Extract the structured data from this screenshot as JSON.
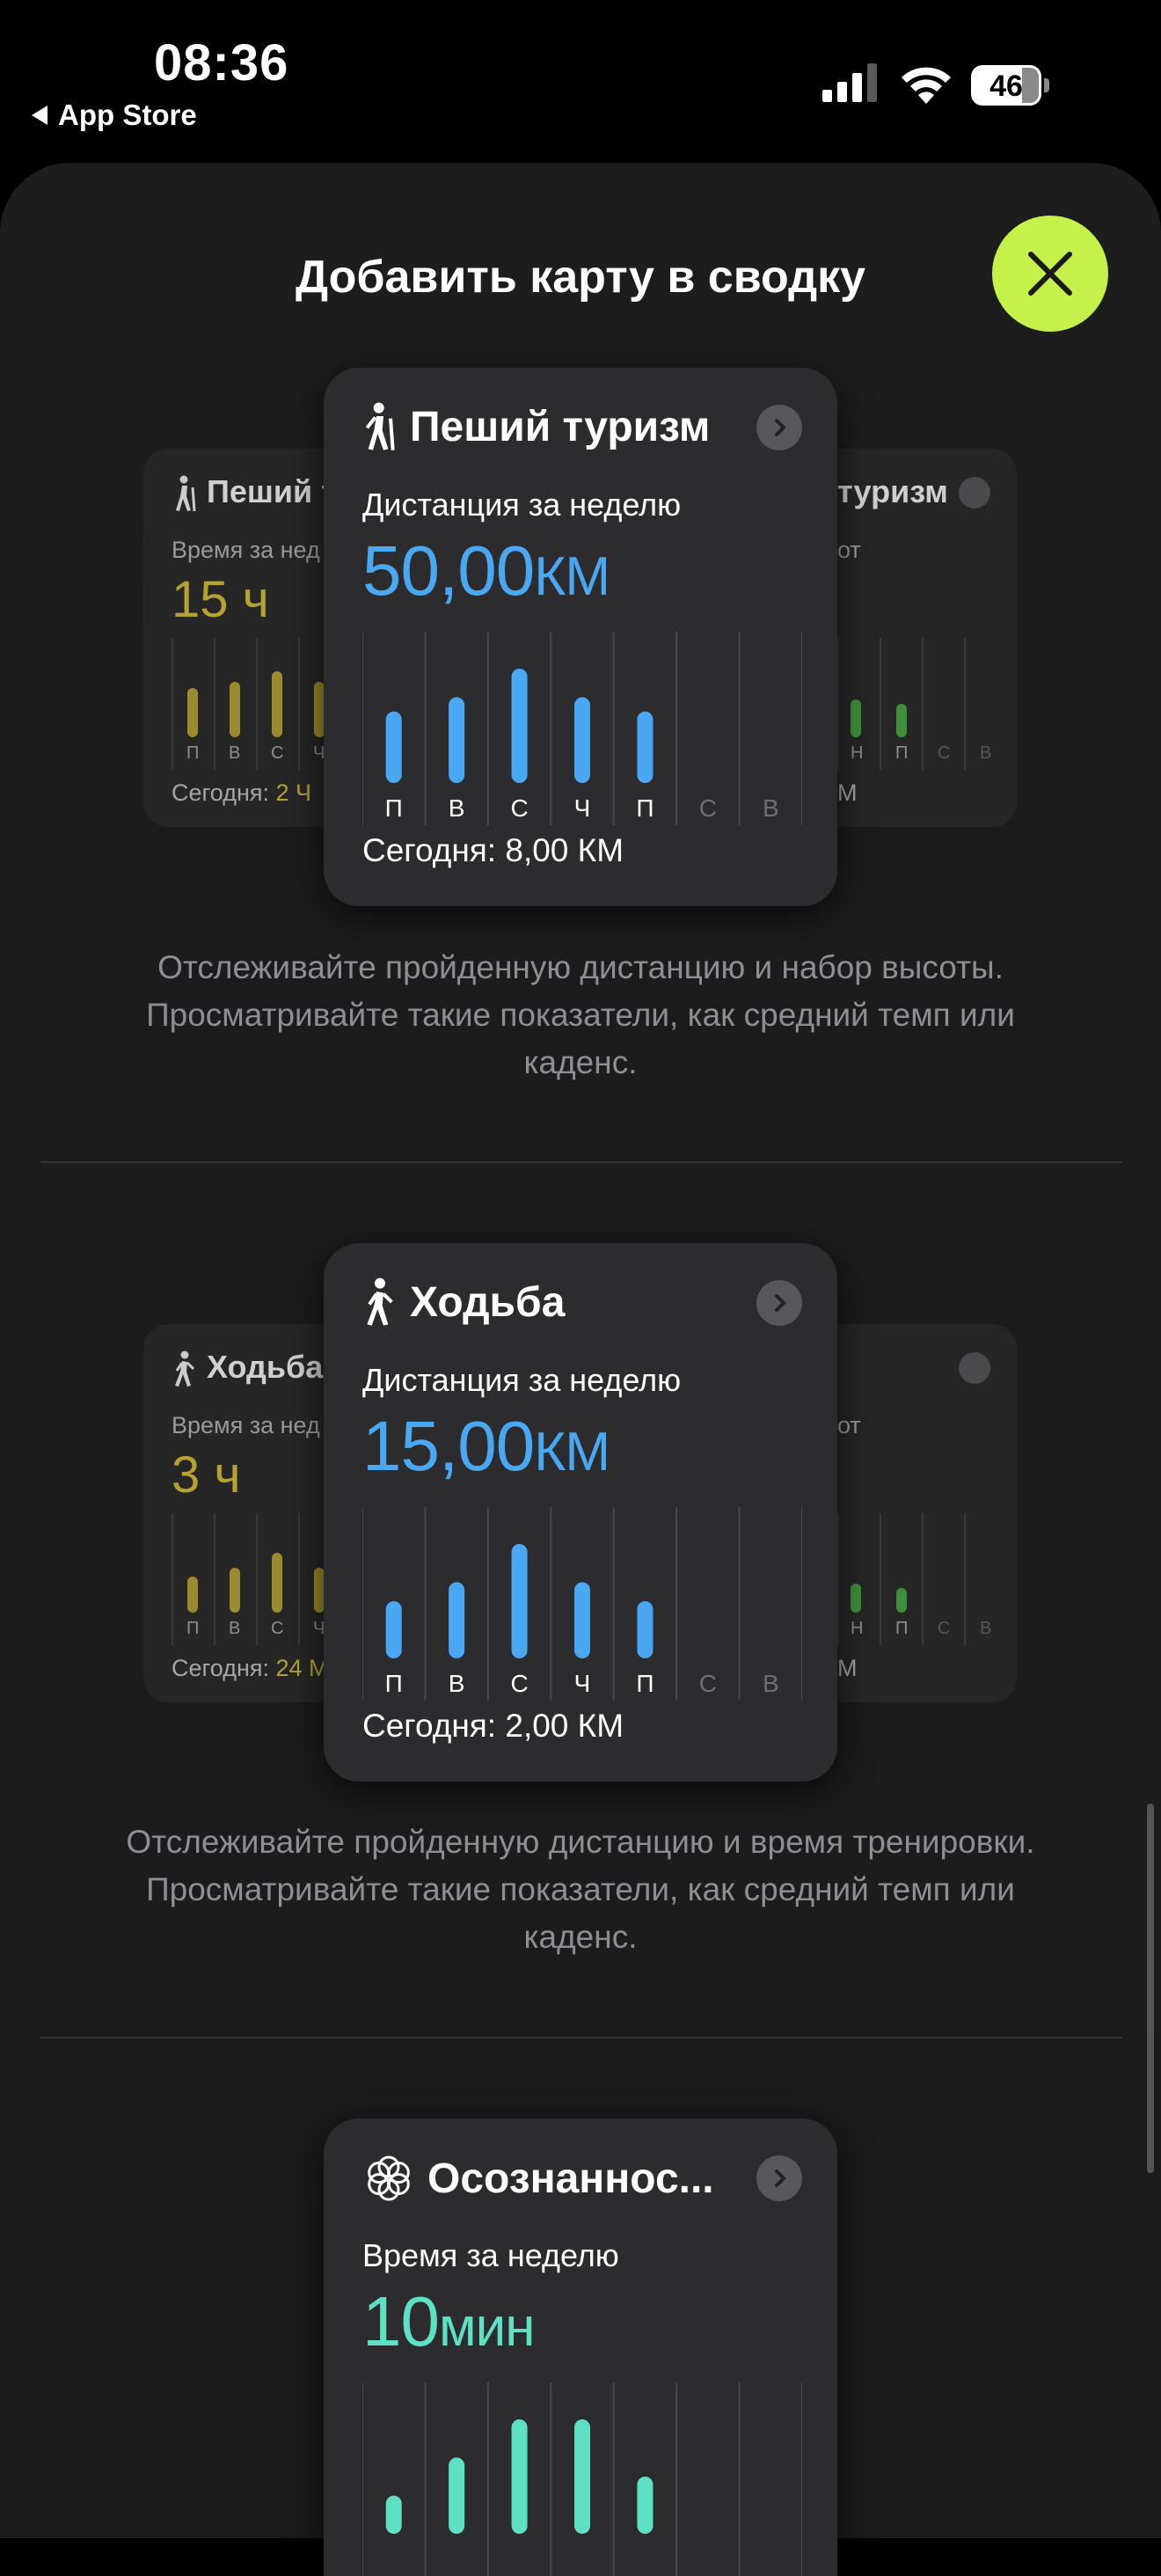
{
  "status_bar": {
    "time": "08:36",
    "back_label": "App Store",
    "battery": "46"
  },
  "sheet": {
    "title": "Добавить карту в сводку"
  },
  "cards": [
    {
      "title": "Пеший туризм",
      "subtitle": "Дистанция за неделю",
      "value": "50,00",
      "unit": "КМ",
      "today": "Сегодня: 8,00 КМ",
      "description": "Отслеживайте пройденную дистанцию и набор высоты. Просматривайте такие показатели, как средний темп или каденс.",
      "left_peek": {
        "title": "Пеший т",
        "subtitle": "Время за нед",
        "value": "15 ч",
        "today_label": "Сегодня: ",
        "today_value": "2 Ч"
      },
      "right_peek": {
        "title": "туризм",
        "subtitle": "от",
        "today": "М"
      }
    },
    {
      "title": "Ходьба",
      "subtitle": "Дистанция за неделю",
      "value": "15,00",
      "unit": "КМ",
      "today": "Сегодня: 2,00 КМ",
      "description": "Отслеживайте пройденную дистанцию и время тренировки. Просматривайте такие показатели, как средний темп или каденс.",
      "left_peek": {
        "title": "Ходьба",
        "subtitle": "Время за нед",
        "value": "3 ч",
        "today_label": "Сегодня: ",
        "today_value": "24 М"
      },
      "right_peek": {
        "subtitle": "от",
        "today": "М"
      }
    },
    {
      "title": "Осознаннос...",
      "subtitle": "Время за неделю",
      "value": "10",
      "unit": "мин"
    }
  ],
  "chart_data": [
    {
      "type": "bar",
      "categories": [
        "П",
        "В",
        "С",
        "Ч",
        "П",
        "С",
        "В"
      ],
      "values": [
        7.5,
        9,
        12,
        9,
        7.5,
        0,
        0
      ],
      "color": "#4aa8f2"
    },
    {
      "type": "bar",
      "categories": [
        "П",
        "В",
        "С",
        "Ч",
        "П",
        "С",
        "В"
      ],
      "values": [
        1.8,
        2.4,
        3.6,
        2.4,
        1.8,
        0,
        0
      ],
      "color": "#4aa8f2"
    },
    {
      "type": "bar",
      "categories": [
        "П",
        "В",
        "С",
        "Ч",
        "П",
        "С",
        "В"
      ],
      "values": [
        1,
        2,
        3,
        3,
        1.5,
        0,
        0
      ],
      "color": "#5ee0c2"
    }
  ],
  "peek_days": [
    "П",
    "В",
    "С",
    "Ч",
    "Н",
    "П",
    "С",
    "В"
  ]
}
